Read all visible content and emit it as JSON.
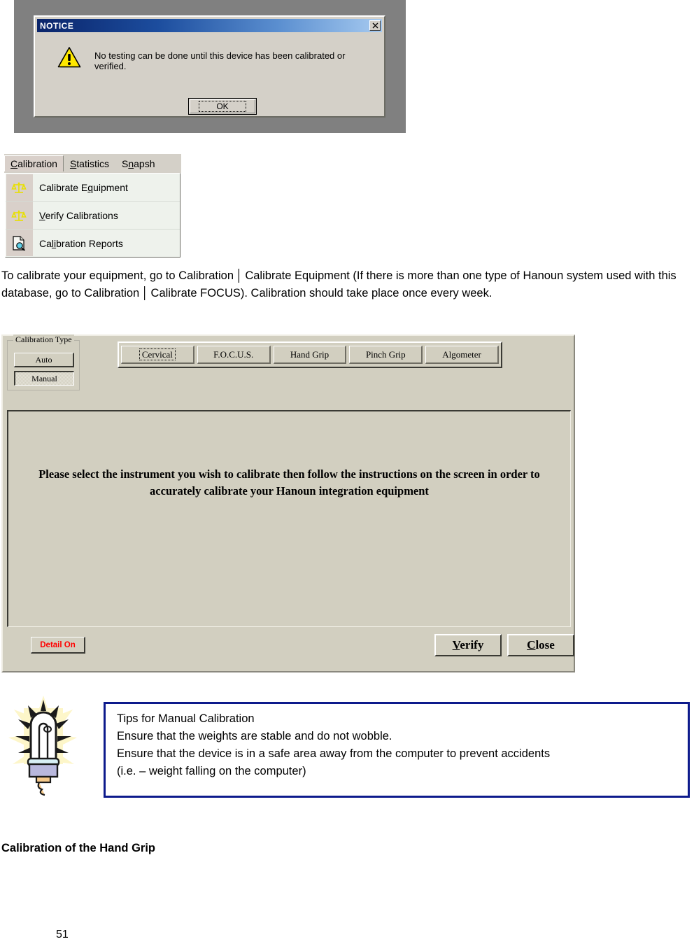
{
  "notice_dialog": {
    "title": "NOTICE",
    "close_label": "✕",
    "warning_icon": "warning-triangle-icon",
    "message": "No testing can be done until this device has been calibrated or verified.",
    "ok_label": "OK"
  },
  "menu_screenshot": {
    "menubar": [
      {
        "label": "Calibration",
        "accel": "C",
        "active": true
      },
      {
        "label": "Statistics",
        "accel": "S",
        "active": false
      },
      {
        "label": "Snapsh",
        "accel": "n",
        "active": false
      }
    ],
    "dropdown_items": [
      {
        "label": "Calibrate Equipment",
        "accel": "q",
        "icon": "balance-scale-icon"
      },
      {
        "label": "Verify Calibrations",
        "accel": "V",
        "icon": "balance-scale-icon"
      },
      {
        "label": "Calibration Reports",
        "accel": "li",
        "icon": "document-search-icon"
      }
    ]
  },
  "paragraph": {
    "part1": "To calibrate your equipment, go to Calibration",
    "sep": "│",
    "part2": "Calibrate Equipment (If there is more than one type of Hanoun system used with this database, go to Calibration",
    "part3": "Calibrate FOCUS).  Calibration should take place once every week."
  },
  "calibration_dialog": {
    "group_title": "Calibration Type",
    "auto_label": "Auto",
    "manual_label": "Manual",
    "instrument_buttons": [
      {
        "label": "Cervical",
        "focused": true
      },
      {
        "label": "F.O.C.U.S.",
        "focused": false
      },
      {
        "label": "Hand Grip",
        "focused": false
      },
      {
        "label": "Pinch Grip",
        "focused": false
      },
      {
        "label": "Algometer",
        "focused": false
      }
    ],
    "instruction_line1": "Please select the instrument you wish to calibrate then follow the instructions on the screen in order to",
    "instruction_line2": "accurately calibrate your Hanoun integration equipment",
    "detail_label": "Detail On",
    "detail_color": "#ff0000",
    "verify_label": "Verify",
    "verify_accel": "V",
    "close_label": "Close",
    "close_accel": "C"
  },
  "tips": {
    "icon": "lightbulb-icon",
    "border_color": "#0d1a8c",
    "line1": "Tips for Manual Calibration",
    "line2": "Ensure that the weights are stable and do not wobble.",
    "line3": "Ensure that the device is in a safe area away from the computer to prevent accidents",
    "line4": "(i.e. – weight falling on the computer)"
  },
  "footer": {
    "section_heading": "Calibration of the Hand Grip",
    "page_number": "51"
  }
}
